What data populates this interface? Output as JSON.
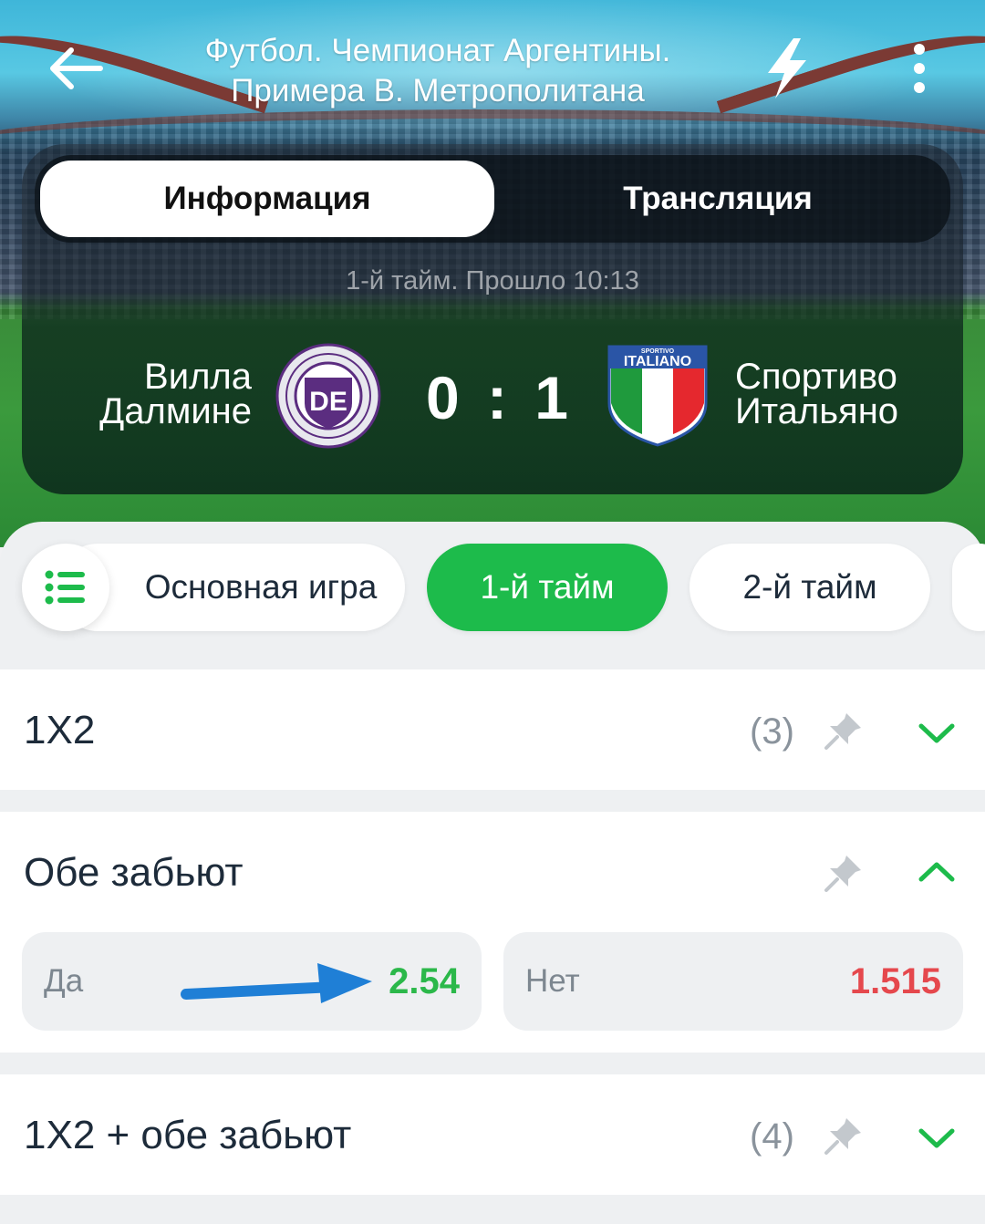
{
  "header": {
    "title_line1": "Футбол. Чемпионат Аргентины.",
    "title_line2": "Примера B. Метрополитана",
    "icons": [
      "back-arrow-icon",
      "lightning-icon",
      "more-vertical-icon"
    ]
  },
  "tabs": [
    {
      "label": "Информация",
      "active": true
    },
    {
      "label": "Трансляция",
      "active": false
    }
  ],
  "match": {
    "period": "1-й тайм. Прошло  10:13",
    "home": {
      "line1": "Вилла",
      "line2": "Далмине",
      "logo_text": "DE"
    },
    "away": {
      "line1": "Спортиво",
      "line2": "Итальяно",
      "logo_text": "ITALIANO",
      "logo_small": "SPORTIVO"
    },
    "score": "0 : 1"
  },
  "periods": [
    {
      "label": "Основная игра",
      "active": false
    },
    {
      "label": "1-й тайм",
      "active": true
    },
    {
      "label": "2-й тайм",
      "active": false
    }
  ],
  "markets": [
    {
      "title": "1X2",
      "count": "(3)",
      "expanded": false
    },
    {
      "title": "Обе забьют",
      "count": "",
      "expanded": true,
      "outcomes": [
        {
          "label": "Да",
          "odd": "2.54",
          "color": "#2bb84a"
        },
        {
          "label": "Нет",
          "odd": "1.515",
          "color": "#e5484d"
        }
      ]
    },
    {
      "title": "1X2 + обе забьют",
      "count": "(4)",
      "expanded": false
    }
  ],
  "colors": {
    "accent_green": "#1dbb4b",
    "odd_up": "#2bb84a",
    "odd_down": "#e5484d",
    "annotation_arrow": "#1f7fd6"
  }
}
